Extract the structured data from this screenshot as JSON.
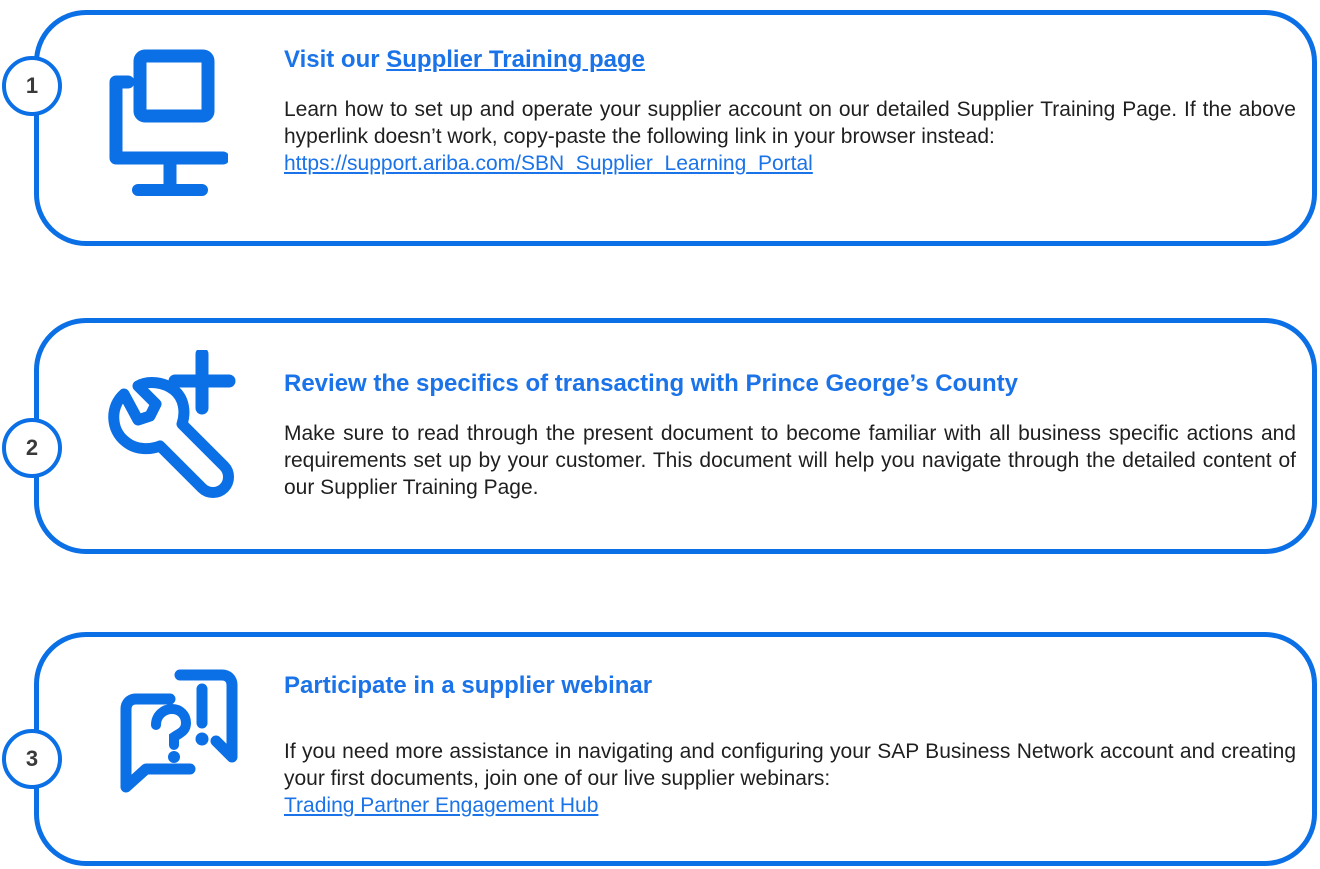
{
  "steps": [
    {
      "number": "1",
      "title_prefix": "Visit our ",
      "title_link": "Supplier Training page",
      "body_text": "Learn how to set up and operate your supplier account on our detailed Supplier Training Page. If the above hyperlink doesn’t work, copy-paste the following link in your browser instead:",
      "body_link": "https://support.ariba.com/SBN_Supplier_Learning_Portal",
      "icon": "computer-monitor-icon"
    },
    {
      "number": "2",
      "title": "Review the specifics of transacting with Prince George’s County",
      "body_text": "Make sure to read through the present document to become familiar with all business specific actions and requirements set up by your customer. This document will help you navigate through the detailed content of our Supplier Training Page.",
      "icon": "wrench-plus-icon"
    },
    {
      "number": "3",
      "title": "Participate in a supplier webinar",
      "body_text": "If you need more assistance in navigating and configuring your SAP Business Network account and creating your first documents, join one of our live supplier webinars:",
      "body_link": "Trading Partner Engagement Hub",
      "icon": "question-exclamation-chat-icon"
    }
  ],
  "colors": {
    "accent": "#0b6fe6",
    "link": "#1a73e8",
    "text": "#1f1f1f",
    "badge_text": "#3a3a3a"
  }
}
